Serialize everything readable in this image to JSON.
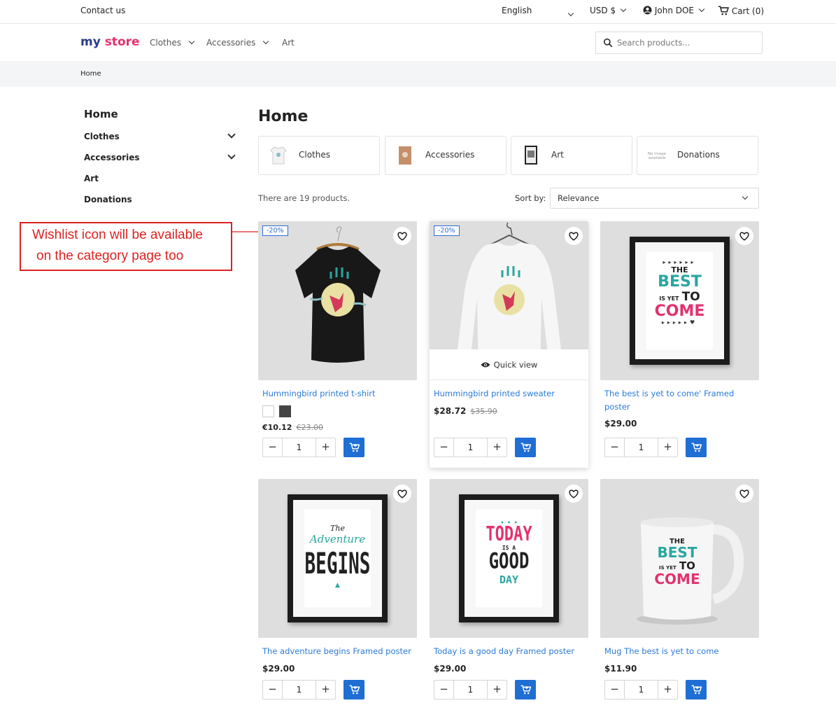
{
  "topbar": {
    "contact": "Contact us",
    "language": "English",
    "currency": "USD $",
    "user": "John DOE",
    "cart": "Cart (0)"
  },
  "logo": {
    "part1": "my",
    "part2": "store"
  },
  "nav": {
    "items": [
      "Clothes",
      "Accessories",
      "Art"
    ]
  },
  "search": {
    "placeholder": "Search products..."
  },
  "breadcrumb": "Home",
  "sidebar": {
    "title": "Home",
    "items": [
      "Clothes",
      "Accessories",
      "Art",
      "Donations"
    ]
  },
  "main": {
    "title": "Home",
    "categories": [
      "Clothes",
      "Accessories",
      "Art",
      "Donations"
    ],
    "noimage": "No image available",
    "count": "There are 19 products.",
    "sort_label": "Sort by:",
    "sort_value": "Relevance"
  },
  "annotation": {
    "line1": "Wishlist icon will be available",
    "line2": "on the category page too"
  },
  "products": [
    {
      "name": "Hummingbird printed t-shirt",
      "price": "€10.12",
      "old": "€23.00",
      "badge": "-20%",
      "qty": "1"
    },
    {
      "name": "Hummingbird printed sweater",
      "price": "$28.72",
      "old": "$35.90",
      "badge": "-20%",
      "qty": "1",
      "quick": "Quick view"
    },
    {
      "name": "The best is yet to come' Framed poster",
      "price": "$29.00",
      "qty": "1"
    },
    {
      "name": "The adventure begins Framed poster",
      "price": "$29.00",
      "qty": "1"
    },
    {
      "name": "Today is a good day Framed poster",
      "price": "$29.00",
      "qty": "1"
    },
    {
      "name": "Mug The best is yet to come",
      "price": "$11.90",
      "qty": "1"
    }
  ],
  "artwork": {
    "best1": "THE",
    "best2": "BEST",
    "best3": "IS YET",
    "best4": "TO",
    "best5": "COME",
    "adv1": "The",
    "adv2": "Adventure",
    "adv3": "BEGINS",
    "today1": "TODAY",
    "today2": "IS A",
    "today3": "GOOD",
    "today4": "DAY"
  },
  "colors": {
    "accent": "#1f6ed4",
    "link": "#2b7bd8",
    "annotation": "#dd2222"
  }
}
